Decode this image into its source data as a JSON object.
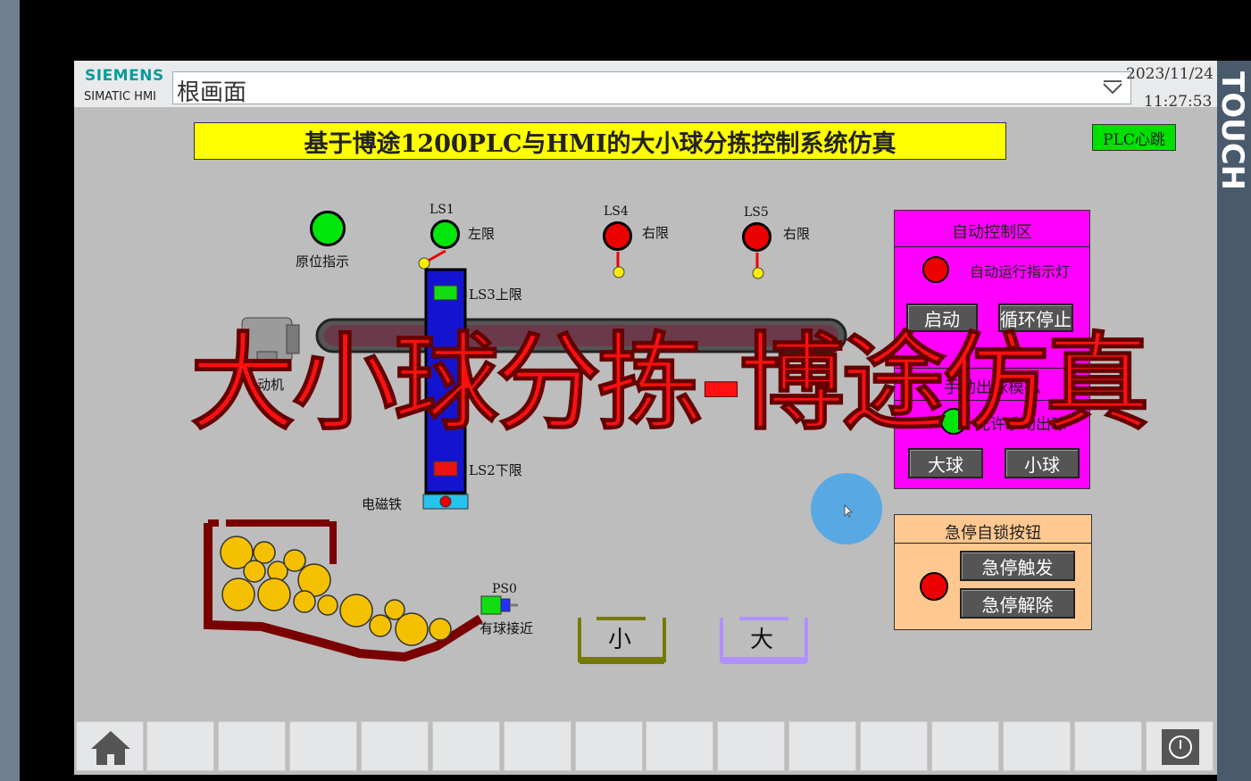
{
  "brand": {
    "name": "SIEMENS",
    "product": "SIMATIC HMI"
  },
  "screen_selector": {
    "value": "根画面"
  },
  "datetime": {
    "date": "2023/11/24",
    "time": "11:27:53"
  },
  "side_label": "TOUCH",
  "title": "基于博途1200PLC与HMI的大小球分拣控制系统仿真",
  "plc_heartbeat": "PLC心跳",
  "indicators": {
    "home": "原位指示",
    "ls1": "LS1",
    "ls1_desc": "左限",
    "ls4": "LS4",
    "ls4_desc": "右限",
    "ls5": "LS5",
    "ls5_desc": "右限",
    "ls3": "LS3上限",
    "ls2": "LS2下限",
    "magnet": "电磁铁",
    "motor": "电动机",
    "ps0": "PS0",
    "ps0_desc": "有球接近"
  },
  "bins": {
    "small": "小",
    "large": "大"
  },
  "auto_zone": {
    "title": "自动控制区",
    "run_lamp": "自动运行指示灯",
    "start_button": "启动",
    "cycle_button": "循环停止"
  },
  "manual_zone": {
    "title": "手动出球模拟",
    "allow_lamp": "允许手动出球",
    "big_button": "大球",
    "small_button": "小球"
  },
  "estop_zone": {
    "title": "急停自锁按钮",
    "trigger_button": "急停触发",
    "release_button": "急停解除"
  },
  "overlay": "大小球分拣-博途仿真",
  "colors": {
    "panel_bg": "#bdbdbd",
    "title_bg": "#ffff00",
    "auto_zone_bg": "#ff00ff",
    "estop_zone_bg": "#ffc890",
    "lamp_green": "#00e60a",
    "lamp_red": "#ee0000",
    "overlay": "#ff1010"
  }
}
